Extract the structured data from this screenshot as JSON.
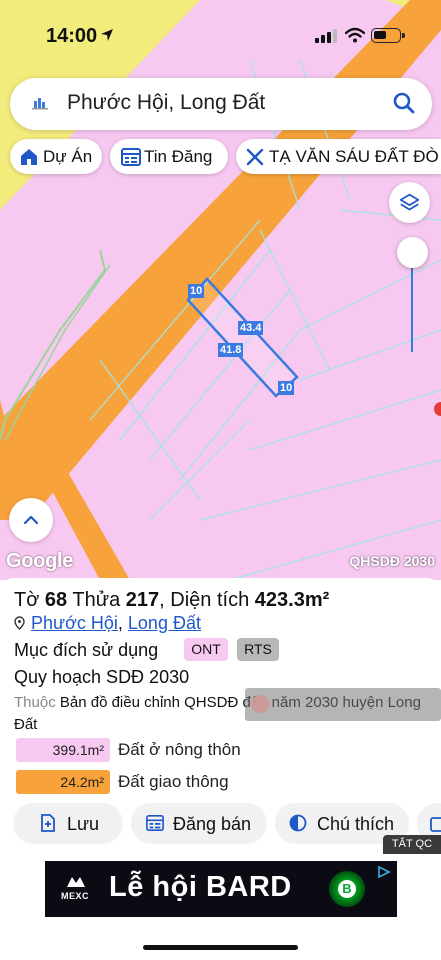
{
  "status_bar": {
    "time": "14:00"
  },
  "search": {
    "query": "Phước Hội, Long Đất"
  },
  "chips": [
    {
      "label": "Dự Án",
      "icon": "house-icon"
    },
    {
      "label": "Tin Đăng",
      "icon": "list-icon"
    },
    {
      "label": "TẠ VĂN SÁU ĐẤT ĐÒ",
      "icon": "tools-icon"
    }
  ],
  "map": {
    "parcel_labels": [
      "10",
      "43.4",
      "41.8",
      "10"
    ],
    "attribution": "Google",
    "map_name": "QHSDĐ 2030",
    "colors": {
      "residential": "#f7c8f0",
      "road": "#f7a23a",
      "farmland": "#f2ec7c",
      "parcel_outline": "#3b7ae0"
    }
  },
  "parcel": {
    "to_label": "Tờ",
    "to": "68",
    "thua_label": "Thửa",
    "thua": "217",
    "area_label": "Diện tích",
    "area": "423.3m²",
    "ward": "Phước Hội",
    "district": "Long Đất",
    "purpose_label": "Mục đích sử dụng",
    "purpose_tags": [
      "ONT",
      "RTS"
    ],
    "plan_label": "Quy hoạch SDĐ 2030",
    "source_prefix": "Thuộc",
    "source_text": "Bản đồ điều chỉnh QHSDĐ đến năm 2030 huyện Long Đất",
    "legend": [
      {
        "area": "399.1m²",
        "label": "Đất ở nông thôn",
        "color": "#f7c8f0"
      },
      {
        "area": "24.2m²",
        "label": "Đất giao thông",
        "color": "#f7a23a"
      }
    ]
  },
  "actions": [
    {
      "label": "Lưu",
      "icon": "save-icon"
    },
    {
      "label": "Đăng bán",
      "icon": "post-icon"
    },
    {
      "label": "Chú thích",
      "icon": "legend-icon"
    }
  ],
  "ad": {
    "close_label": "TẮT QC",
    "brand": "MEXC",
    "text": "Lễ hội BARD"
  }
}
